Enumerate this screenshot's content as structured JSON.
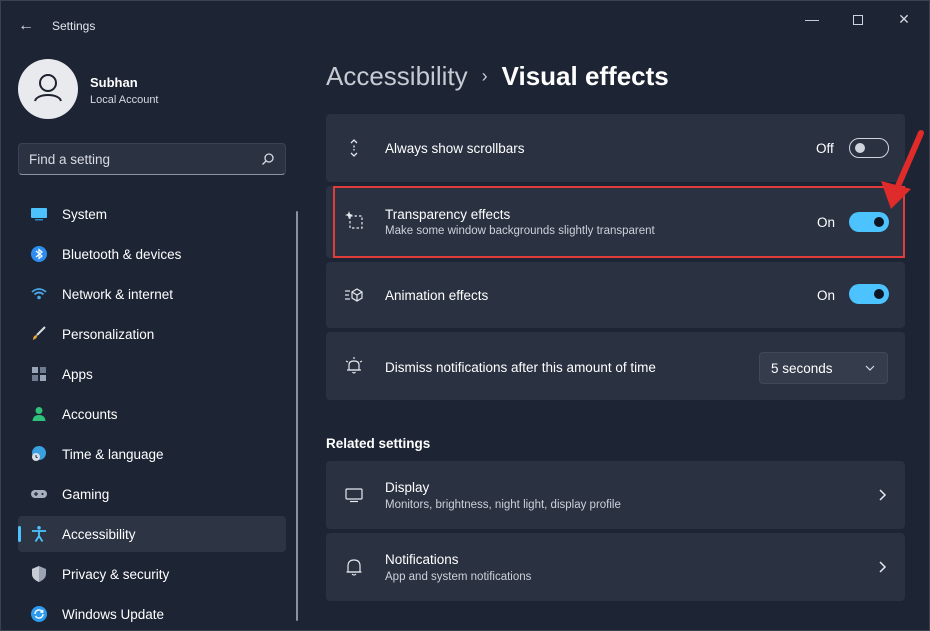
{
  "window": {
    "title": "Settings",
    "back_glyph": "←",
    "minimize_glyph": "—",
    "close_glyph": "✕"
  },
  "profile": {
    "name": "Subhan",
    "account_type": "Local Account"
  },
  "search": {
    "placeholder": "Find a setting",
    "icon": "search-icon"
  },
  "nav": {
    "items": [
      {
        "label": "System",
        "icon": "system-icon",
        "color": "#4cc2ff"
      },
      {
        "label": "Bluetooth & devices",
        "icon": "bluetooth-icon",
        "color": "#2d8ef0"
      },
      {
        "label": "Network & internet",
        "icon": "wifi-icon",
        "color": "#4aa8e8"
      },
      {
        "label": "Personalization",
        "icon": "brush-icon",
        "color": "#e8a23c"
      },
      {
        "label": "Apps",
        "icon": "apps-icon",
        "color": "#9aa6b8"
      },
      {
        "label": "Accounts",
        "icon": "account-icon",
        "color": "#2fc07a"
      },
      {
        "label": "Time & language",
        "icon": "globe-clock-icon",
        "color": "#3aa0e0"
      },
      {
        "label": "Gaming",
        "icon": "gamepad-icon",
        "color": "#a8b0bf"
      },
      {
        "label": "Accessibility",
        "icon": "accessibility-icon",
        "color": "#4cc2ff"
      },
      {
        "label": "Privacy & security",
        "icon": "shield-icon",
        "color": "#9aa3b2"
      },
      {
        "label": "Windows Update",
        "icon": "update-icon",
        "color": "#2d9cf0"
      }
    ],
    "active_index": 8
  },
  "breadcrumb": {
    "parent": "Accessibility",
    "separator": "›",
    "current": "Visual effects"
  },
  "settings": {
    "scrollbars": {
      "title": "Always show scrollbars",
      "state_label": "Off",
      "checked": false,
      "icon": "scrollbar-arrows-icon"
    },
    "transparency": {
      "title": "Transparency effects",
      "description": "Make some window backgrounds slightly transparent",
      "state_label": "On",
      "checked": true,
      "icon": "transparency-sparkle-icon"
    },
    "animation": {
      "title": "Animation effects",
      "state_label": "On",
      "checked": true,
      "icon": "animation-icon"
    },
    "notifications_timeout": {
      "title": "Dismiss notifications after this amount of time",
      "value": "5 seconds",
      "icon": "notification-dismiss-icon"
    }
  },
  "related": {
    "heading": "Related settings",
    "display": {
      "title": "Display",
      "description": "Monitors, brightness, night light, display profile",
      "icon": "monitor-icon"
    },
    "notifications": {
      "title": "Notifications",
      "description": "App and system notifications",
      "icon": "bell-icon"
    }
  },
  "colors": {
    "accent": "#4cc2ff",
    "highlight": "#e03c3c",
    "background": "#1d2434",
    "card": "#2a3141"
  }
}
